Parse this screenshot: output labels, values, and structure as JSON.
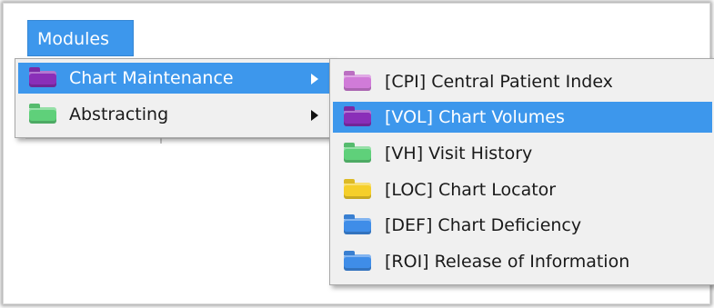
{
  "menubar": {
    "modules_label": "Modules"
  },
  "main_menu": {
    "items": [
      {
        "label": "Chart Maintenance",
        "icon": "purple-folder-icon",
        "color": "#8a2fb8",
        "selected": true,
        "has_submenu": true
      },
      {
        "label": "Abstracting",
        "icon": "green-folder-icon",
        "color": "#5fd07a",
        "selected": false,
        "has_submenu": true
      }
    ]
  },
  "submenu": {
    "items": [
      {
        "label": "[CPI] Central Patient Index",
        "icon": "lavender-folder-icon",
        "color": "#d07bd8"
      },
      {
        "label": "[VOL] Chart Volumes",
        "icon": "purple-folder-icon",
        "color": "#8a2fb8",
        "selected": true
      },
      {
        "label": "[VH] Visit History",
        "icon": "green-folder-icon",
        "color": "#5fd07a"
      },
      {
        "label": "[LOC] Chart Locator",
        "icon": "yellow-folder-icon",
        "color": "#f5cf2a"
      },
      {
        "label": "[DEF] Chart Deficiency",
        "icon": "blue-folder-icon",
        "color": "#3f8de8"
      },
      {
        "label": "[ROI] Release of Information",
        "icon": "blue-folder-icon",
        "color": "#3f8de8"
      }
    ]
  },
  "colors": {
    "accent": "#3d97ec",
    "menu_bg": "#f0f0f0"
  }
}
